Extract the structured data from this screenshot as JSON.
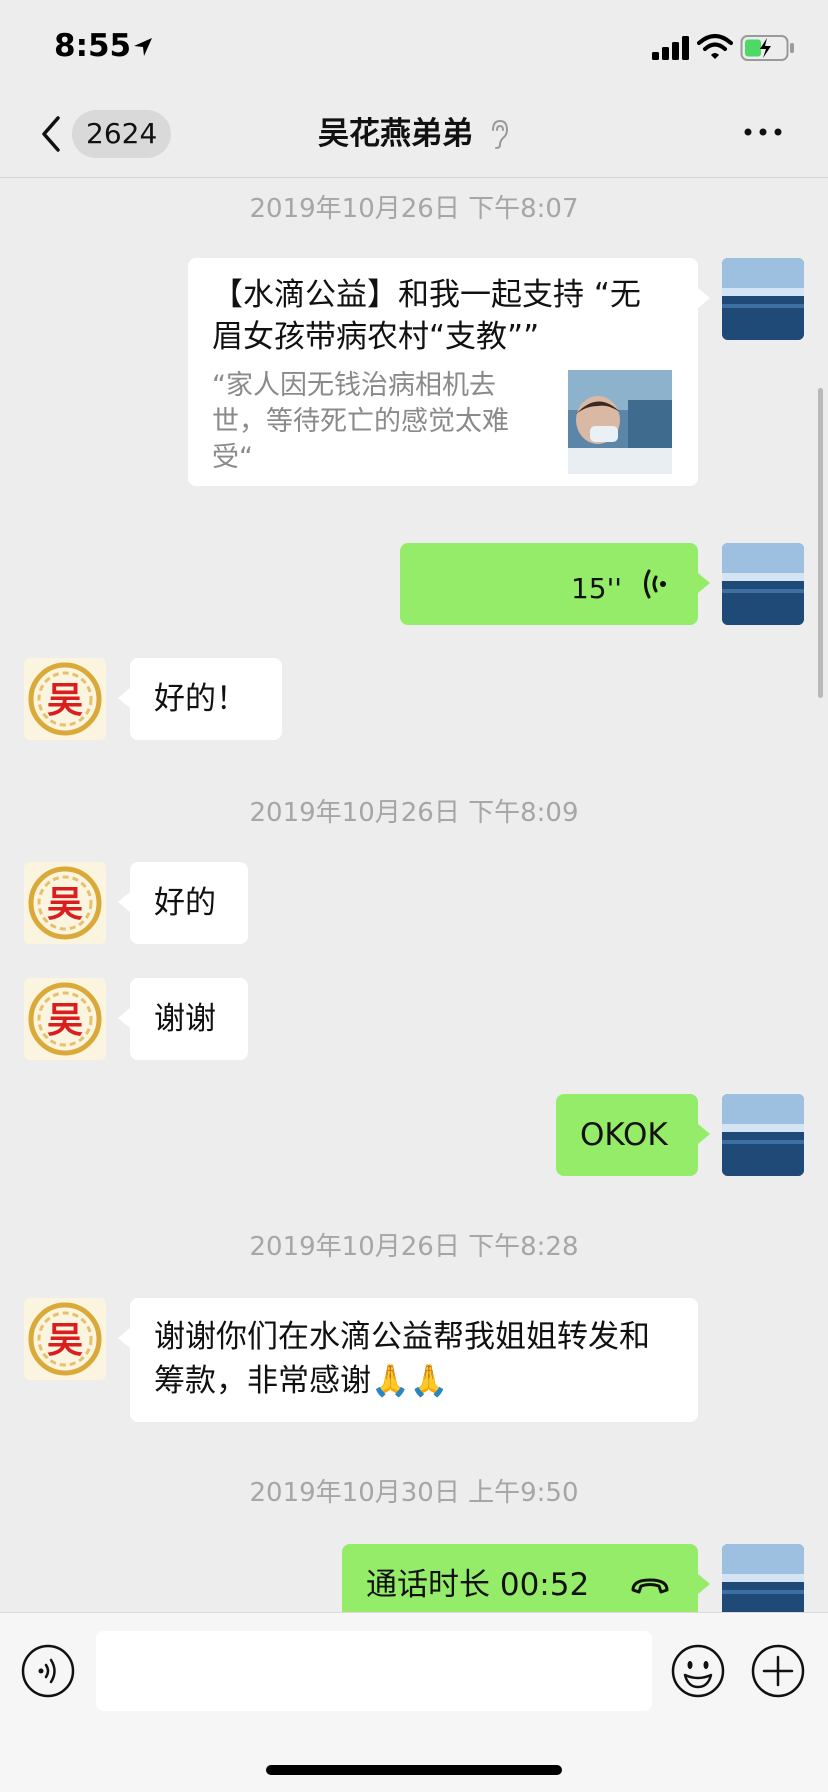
{
  "status_bar": {
    "time": "8:55"
  },
  "nav": {
    "unread_count": "2624",
    "title": "吴花燕弟弟"
  },
  "avatar_text": "吴",
  "messages": {
    "ts1": "2019年10月26日 下午8:07",
    "card": {
      "title": "【水滴公益】和我一起支持 “无眉女孩带病农村“支教””",
      "desc": "“家人因无钱治病相机去世，等待死亡的感觉太难受“"
    },
    "voice_duration": "15''",
    "reply1": "好的！",
    "ts2": "2019年10月26日 下午8:09",
    "reply2": "好的",
    "reply3": "谢谢",
    "mine_okok": "OKOK",
    "ts3": "2019年10月26日 下午8:28",
    "reply4": "谢谢你们在水滴公益帮我姐姐转发和筹款，非常感谢🙏🙏",
    "ts4": "2019年10月30日 上午9:50",
    "call_text": "通话时长 00:52"
  },
  "colors": {
    "chat_bg": "#ededed",
    "my_bubble": "#95ec69",
    "other_bubble": "#ffffff",
    "timestamp": "#a6a6a6"
  },
  "icons": [
    "location-arrow-icon",
    "signal-icon",
    "wifi-icon",
    "battery-icon",
    "back-chevron-icon",
    "ear-icon",
    "more-dots-icon",
    "voice-wave-icon",
    "phone-hangup-icon",
    "voice-mode-icon",
    "emoji-icon",
    "plus-icon"
  ]
}
